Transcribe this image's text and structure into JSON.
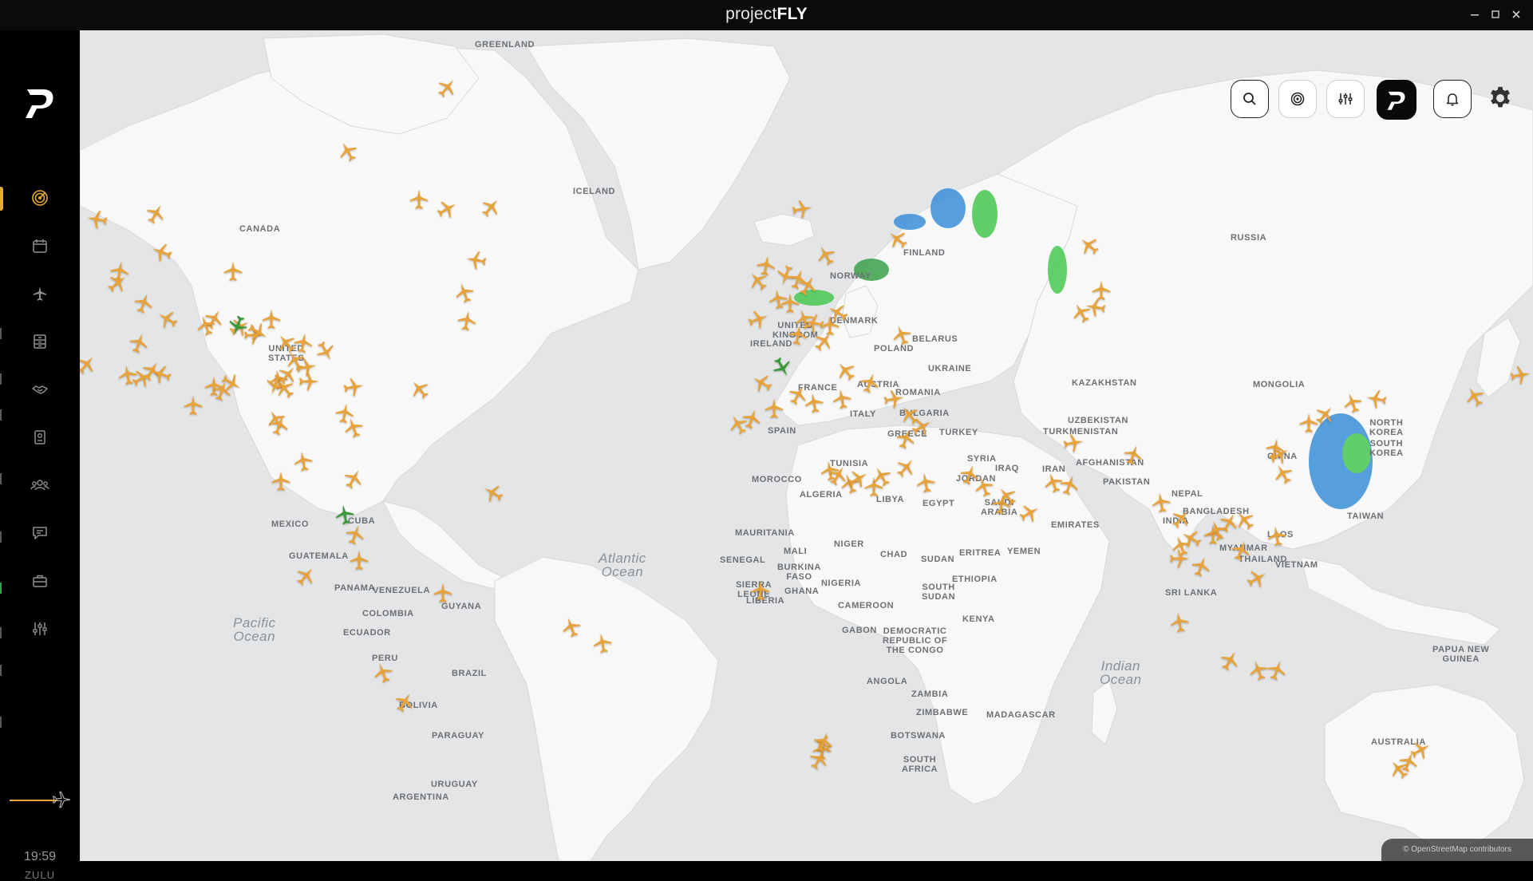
{
  "app": {
    "title_thin": "project",
    "title_bold": "FLY",
    "window_controls": [
      "minimize-icon",
      "maximize-icon",
      "close-icon"
    ]
  },
  "sidebar": {
    "logo": "projectfly-logo",
    "items": [
      {
        "name": "live-map",
        "icon": "radar-icon",
        "active": true
      },
      {
        "name": "schedule",
        "icon": "calendar-icon",
        "active": false
      },
      {
        "name": "flights",
        "icon": "plane-icon",
        "active": false
      },
      {
        "name": "logbook",
        "icon": "archive-icon",
        "active": false
      },
      {
        "name": "partners",
        "icon": "handshake-icon",
        "active": false
      },
      {
        "name": "pilot-id",
        "icon": "id-badge-icon",
        "active": false
      },
      {
        "name": "community",
        "icon": "group-icon",
        "active": false
      },
      {
        "name": "messages",
        "icon": "chat-icon",
        "active": false
      },
      {
        "name": "jobs",
        "icon": "briefcase-icon",
        "active": false
      },
      {
        "name": "settings",
        "icon": "sliders-icon",
        "active": false
      }
    ],
    "time": "19:59",
    "zone": "ZULU",
    "accent": "#e5a935"
  },
  "toolbar": [
    {
      "name": "search",
      "icon": "search-icon"
    },
    {
      "name": "radar",
      "icon": "radar-icon"
    },
    {
      "name": "filters",
      "icon": "sliders-icon"
    },
    {
      "name": "projectfly",
      "icon": "projectfly-logo"
    },
    {
      "name": "notifications",
      "icon": "bell-icon"
    },
    {
      "name": "settings",
      "icon": "gear-icon"
    }
  ],
  "map": {
    "ocean_color": "#e3e5e6",
    "land_color": "#f8f8f8",
    "plane_color": "#e8a23a",
    "plane_color_alt": "#3a9a3a",
    "labels": {
      "greenland": "GREENLAND",
      "iceland": "ICELAND",
      "canada": "CANADA",
      "united_states": "UNITED\nSTATES",
      "mexico": "MEXICO",
      "cuba": "CUBA",
      "guatemala": "GUATEMALA",
      "panama": "PANAMA",
      "venezuela": "VENEZUELA",
      "colombia": "COLOMBIA",
      "guyana": "GUYANA",
      "ecuador": "ECUADOR",
      "peru": "PERU",
      "brazil": "BRAZIL",
      "bolivia": "BOLIVIA",
      "paraguay": "PARAGUAY",
      "uruguay": "URUGUAY",
      "argentina": "ARGENTINA",
      "finland": "FINLAND",
      "norway": "NORWAY",
      "united_kingdom": "UNITED\nKINGDOM",
      "ireland": "IRELAND",
      "denmark": "DENMARK",
      "poland": "POLAND",
      "belarus": "BELARUS",
      "ukraine": "UKRAINE",
      "france": "FRANCE",
      "austria": "AUSTRIA",
      "romania": "ROMANIA",
      "italy": "ITALY",
      "bulgaria": "BULGARIA",
      "greece": "GREECE",
      "spain": "SPAIN",
      "turkey": "TURKEY",
      "syria": "SYRIA",
      "iraq": "IRAQ",
      "iran": "IRAN",
      "jordan": "JORDAN",
      "tunisia": "TUNISIA",
      "morocco": "MOROCCO",
      "algeria": "ALGERIA",
      "libya": "LIBYA",
      "egypt": "EGYPT",
      "saudi_arabia": "SAUDI\nARABIA",
      "emirates": "EMIRATES",
      "yemen": "YEMEN",
      "eritrea": "ERITREA",
      "ethiopia": "ETHIOPIA",
      "sudan": "SUDAN",
      "south_sudan": "SOUTH\nSUDAN",
      "mauritania": "MAURITANIA",
      "mali": "MALI",
      "niger": "NIGER",
      "chad": "CHAD",
      "senegal": "SENEGAL",
      "burkina_faso": "BURKINA\nFASO",
      "nigeria": "NIGERIA",
      "ghana": "GHANA",
      "sierra_leone": "SIERRA\nLEONE",
      "liberia": "LIBERIA",
      "cameroon": "CAMEROON",
      "gabon": "GABON",
      "drc": "DEMOCRATIC\nREPUBLIC OF\nTHE CONGO",
      "kenya": "KENYA",
      "angola": "ANGOLA",
      "zambia": "ZAMBIA",
      "zimbabwe": "ZIMBABWE",
      "botswana": "BOTSWANA",
      "madagascar": "MADAGASCAR",
      "south_africa": "SOUTH\nAFRICA",
      "russia": "RUSSIA",
      "kazakhstan": "KAZAKHSTAN",
      "uzbekistan": "UZBEKISTAN",
      "turkmenistan": "TURKMENISTAN",
      "afghanistan": "AFGHANISTAN",
      "pakistan": "PAKISTAN",
      "india": "INDIA",
      "nepal": "NEPAL",
      "bangladesh": "BANGLADESH",
      "sri_lanka": "SRI LANKA",
      "myanmar": "MYANMAR",
      "thailand": "THAILAND",
      "laos": "LAOS",
      "vietnam": "VIETNAM",
      "mongolia": "MONGOLIA",
      "china": "CHINA",
      "north_korea": "NORTH\nKOREA",
      "south_korea": "SOUTH\nKOREA",
      "taiwan": "TAIWAN",
      "papua_new_guinea": "PAPUA NEW\nGUINEA",
      "australia": "AUSTRALIA"
    },
    "oceans": {
      "atlantic": "Atlantic\nOcean",
      "pacific": "Pacific\nOcean",
      "indian": "Indian\nOcean"
    }
  },
  "footer": {
    "copyright": "© OpenStreetMap contributors"
  }
}
